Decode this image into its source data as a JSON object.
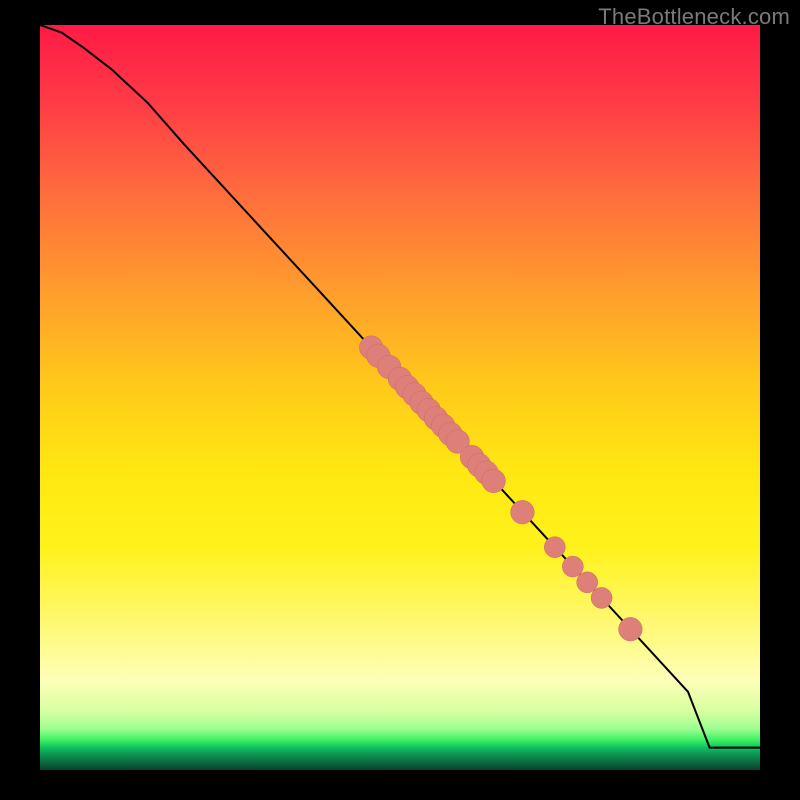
{
  "watermark": "TheBottleneck.com",
  "colors": {
    "curve_stroke": "#000000",
    "marker_fill": "#df7f7a",
    "marker_stroke": "#c76a66"
  },
  "chart_data": {
    "type": "line",
    "title": "",
    "xlabel": "",
    "ylabel": "",
    "xlim": [
      0,
      100
    ],
    "ylim": [
      0,
      100
    ],
    "series": [
      {
        "name": "curve",
        "x": [
          0,
          3,
          6,
          10,
          15,
          20,
          30,
          40,
          50,
          60,
          70,
          80,
          90,
          93,
          100
        ],
        "y": [
          100,
          99,
          97,
          94,
          89.5,
          84,
          73.5,
          63,
          52.5,
          42,
          31.5,
          21,
          10.5,
          3,
          3
        ]
      }
    ],
    "markers": [
      {
        "x": 46,
        "y": 56.7,
        "r": 1.2
      },
      {
        "x": 47,
        "y": 55.6,
        "r": 1.2
      },
      {
        "x": 48.5,
        "y": 54.1,
        "r": 1.2
      },
      {
        "x": 50,
        "y": 52.5,
        "r": 1.2
      },
      {
        "x": 51,
        "y": 51.4,
        "r": 1.2
      },
      {
        "x": 52,
        "y": 50.4,
        "r": 1.2
      },
      {
        "x": 53,
        "y": 49.3,
        "r": 1.2
      },
      {
        "x": 54,
        "y": 48.3,
        "r": 1.2
      },
      {
        "x": 55,
        "y": 47.2,
        "r": 1.2
      },
      {
        "x": 56,
        "y": 46.2,
        "r": 1.2
      },
      {
        "x": 57,
        "y": 45.1,
        "r": 1.2
      },
      {
        "x": 58,
        "y": 44.1,
        "r": 1.2
      },
      {
        "x": 60,
        "y": 42.0,
        "r": 1.2
      },
      {
        "x": 61,
        "y": 40.9,
        "r": 1.2
      },
      {
        "x": 62,
        "y": 39.9,
        "r": 1.2
      },
      {
        "x": 63,
        "y": 38.8,
        "r": 1.2
      },
      {
        "x": 67,
        "y": 34.6,
        "r": 1.2
      },
      {
        "x": 71.5,
        "y": 29.9,
        "r": 1.0
      },
      {
        "x": 74,
        "y": 27.3,
        "r": 1.0
      },
      {
        "x": 76,
        "y": 25.2,
        "r": 1.0
      },
      {
        "x": 78,
        "y": 23.1,
        "r": 1.0
      },
      {
        "x": 82,
        "y": 18.9,
        "r": 1.2
      }
    ]
  }
}
